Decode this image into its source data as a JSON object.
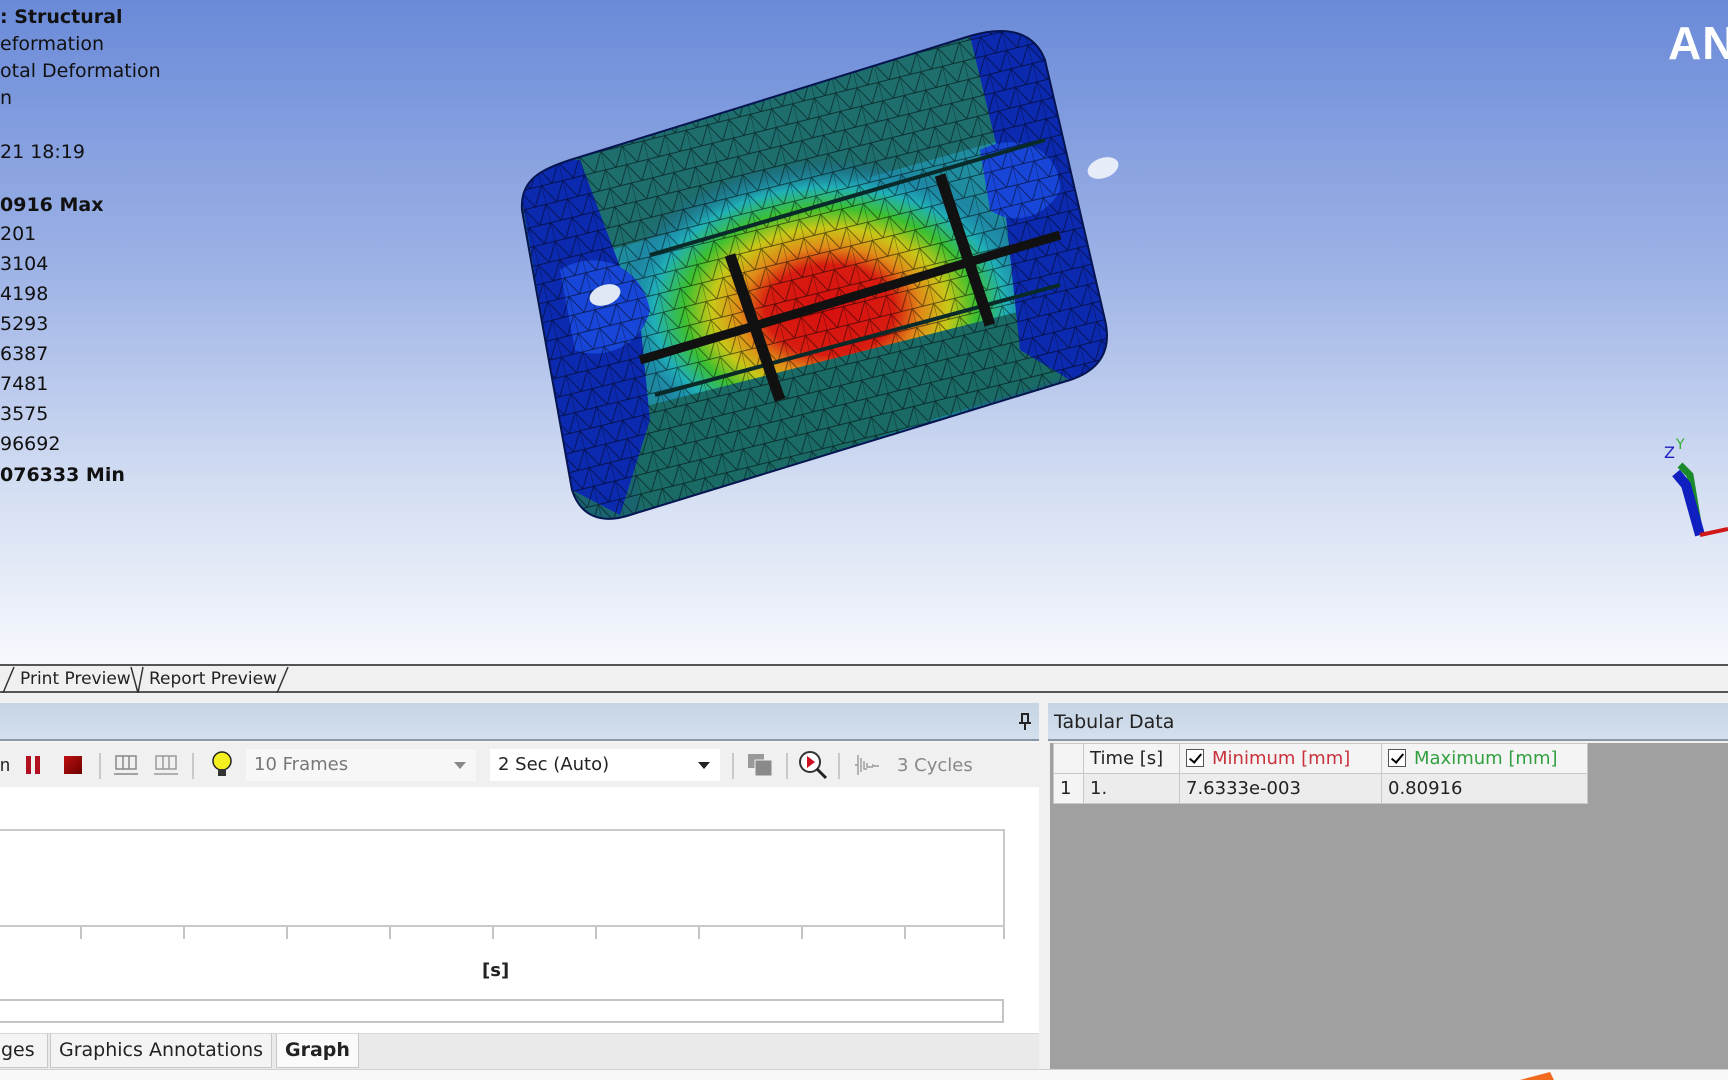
{
  "viewport": {
    "legend": {
      "title": ": Structural",
      "line2": "eformation",
      "line3": "otal Deformation",
      "line4": "n",
      "timestamp": "21 18:19",
      "max_value": "0916 Max",
      "levels": [
        "201",
        "3104",
        "4198",
        "5293",
        "6387",
        "7481",
        "3575",
        "96692"
      ],
      "min_value": "076333 Min"
    },
    "logo": "AN",
    "triad": {
      "z": "Z",
      "y": "Y"
    },
    "colors": {
      "max": "#d01010",
      "min": "#0a1aa0",
      "mesh_base": "#1a6a6a"
    }
  },
  "view_tabs": [
    "Print Preview",
    "Report Preview"
  ],
  "animation": {
    "frames_label": "10 Frames",
    "duration_label": "2 Sec (Auto)",
    "cycles_label": "3 Cycles",
    "graph_xlabel": "[s]",
    "icons": [
      "play-icon",
      "pause-icon",
      "stop-icon",
      "previous-frame-icon",
      "next-frame-icon",
      "lightbulb-icon",
      "export-video-icon",
      "zoom-to-fit-icon",
      "cycle-icon"
    ]
  },
  "bottom_tabs": [
    {
      "label": "ges",
      "active": false
    },
    {
      "label": "Graphics Annotations",
      "active": false
    },
    {
      "label": "Graph",
      "active": true
    }
  ],
  "tabular": {
    "title": "Tabular Data",
    "columns": [
      "Time [s]",
      "Minimum [mm]",
      "Maximum [mm]"
    ],
    "rows": [
      {
        "index": "1",
        "time": "1.",
        "min": "7.6333e-003",
        "max": "0.80916"
      }
    ],
    "min_checked": true,
    "max_checked": true
  }
}
